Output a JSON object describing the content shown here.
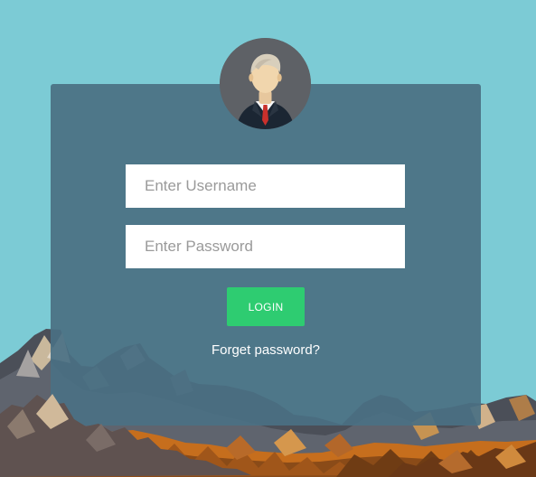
{
  "login": {
    "username_placeholder": "Enter Username",
    "password_placeholder": "Enter Password",
    "login_label": "LOGIN",
    "forgot_label": "Forget password?"
  },
  "colors": {
    "background": "#7ccbd5",
    "card": "#4a7083",
    "login_button": "#2ecc71",
    "avatar_bg": "#5e6166"
  },
  "icons": {
    "avatar": "businessman-avatar-icon"
  }
}
